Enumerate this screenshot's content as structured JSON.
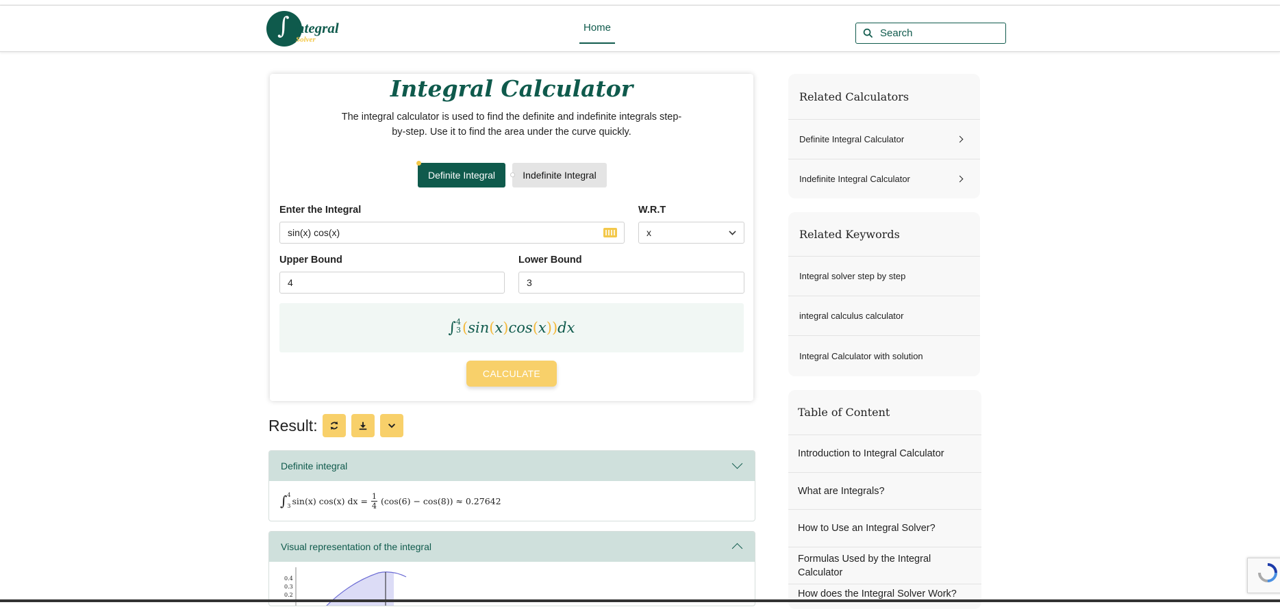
{
  "header": {
    "logo_mark": "∫",
    "logo_text": "integral",
    "logo_sub": "Solver",
    "nav_home": "Home",
    "search_placeholder": "Search"
  },
  "calculator": {
    "title": "Integral Calculator",
    "description": "The integral calculator is used to find the definite and indefinite integrals step-by-step. Use it to find the area under the curve quickly.",
    "tab_definite": "Definite Integral",
    "tab_indefinite": "Indefinite Integral",
    "enter_label": "Enter the Integral",
    "integral_value": "sin(x) cos(x)",
    "wrt_label": "W.R.T",
    "wrt_value": "x",
    "upper_label": "Upper Bound",
    "upper_value": "4",
    "lower_label": "Lower Bound",
    "lower_value": "3",
    "preview": {
      "sign": "∫",
      "lower": "3",
      "upper": "4",
      "lp1": "(",
      "fn1": "sin",
      "lp2": "(",
      "var1": "x",
      "rp2": ")",
      "fn2": "cos",
      "lp3": "(",
      "var2": "x",
      "rp3": ")",
      "rp1": ")",
      "dx": "dx"
    },
    "calculate_label": "CALCULATE"
  },
  "result": {
    "label": "Result:",
    "definite_title": "Definite integral",
    "definite_formula": {
      "sign": "∫",
      "lower": "3",
      "upper": "4",
      "integrand": "sin(x) cos(x) dx =",
      "num": "1",
      "den": "4",
      "rest": "(cos(6) − cos(8)) ≈ 0.27642"
    },
    "visual_title": "Visual representation of the integral",
    "plot_ticks": [
      "0.4",
      "0.3",
      "0.2"
    ]
  },
  "sidebar": {
    "related_calculators_title": "Related Calculators",
    "related_calculators": [
      "Definite Integral Calculator",
      "Indefinite Integral Calculator"
    ],
    "related_keywords_title": "Related Keywords",
    "related_keywords": [
      "Integral solver step by step",
      "integral calculus calculator",
      "Integral Calculator with solution"
    ],
    "toc_title": "Table of Content",
    "toc": [
      "Introduction to Integral Calculator",
      "What are Integrals?",
      "How to Use an Integral Solver?",
      "Formulas Used by the Integral Calculator",
      "How does the Integral Solver Work?"
    ]
  },
  "colors": {
    "brand": "#0f5a4c",
    "accent": "#f8d06a",
    "accordion_head": "#cfe0dc"
  }
}
